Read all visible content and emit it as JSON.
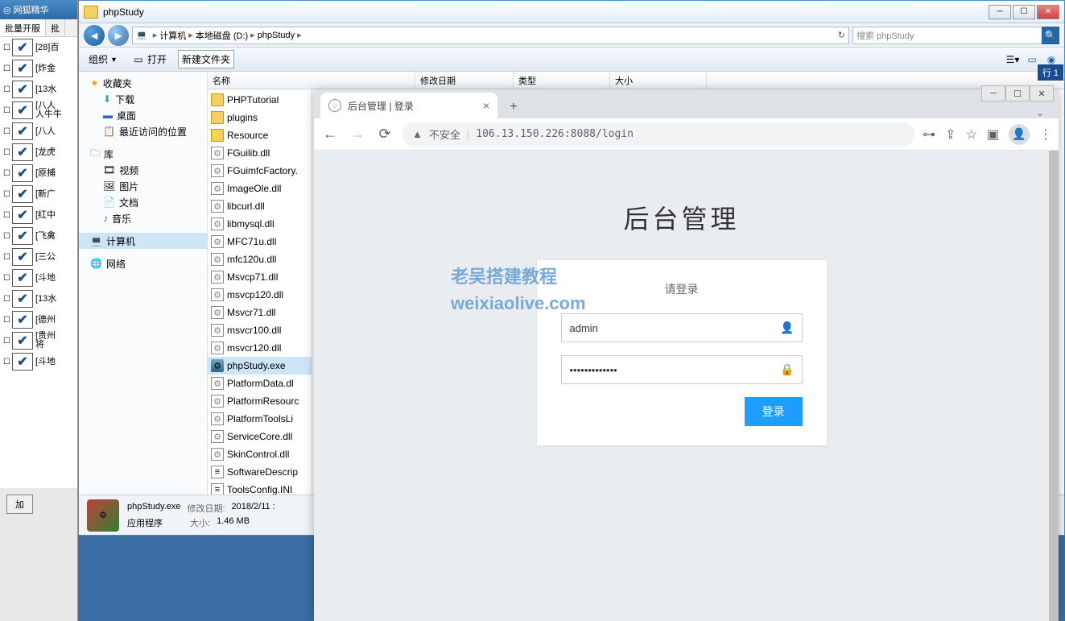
{
  "bg_app": {
    "title": "网狐精华",
    "tabs": [
      "批量开服",
      "批"
    ],
    "items": [
      "[28]百",
      "[炸金",
      "[13水",
      "[八人\n人牛牛",
      "[八人",
      "[龙虎",
      "[原捕",
      "[新广",
      "[红中",
      "[飞禽",
      "[三公",
      "[斗地",
      "[13水",
      "[德州",
      "[贵州\n将",
      "[斗地"
    ],
    "add_btn": "加"
  },
  "explorer": {
    "title": "phpStudy",
    "breadcrumb": [
      "计算机",
      "本地磁盘 (D:)",
      "phpStudy"
    ],
    "search_placeholder": "搜索 phpStudy",
    "toolbar": {
      "org": "组织",
      "open": "打开",
      "newfolder": "新建文件夹"
    },
    "columns": {
      "name": "名称",
      "date": "修改日期",
      "type": "类型",
      "size": "大小"
    },
    "col_widths": {
      "name": 258,
      "date": 122,
      "type": 120,
      "size": 120
    },
    "nav": {
      "favorites": {
        "label": "收藏夹",
        "items": [
          "下载",
          "桌面",
          "最近访问的位置"
        ]
      },
      "libraries": {
        "label": "库",
        "items": [
          "视频",
          "图片",
          "文档",
          "音乐"
        ]
      },
      "computer": "计算机",
      "network": "网络"
    },
    "files": [
      {
        "name": "PHPTutorial",
        "type": "folder"
      },
      {
        "name": "plugins",
        "type": "folder"
      },
      {
        "name": "Resource",
        "type": "folder"
      },
      {
        "name": "FGuilib.dll",
        "type": "dll"
      },
      {
        "name": "FGuimfcFactory.",
        "type": "dll"
      },
      {
        "name": "ImageOle.dll",
        "type": "dll"
      },
      {
        "name": "libcurl.dll",
        "type": "dll"
      },
      {
        "name": "libmysql.dll",
        "type": "dll"
      },
      {
        "name": "MFC71u.dll",
        "type": "dll"
      },
      {
        "name": "mfc120u.dll",
        "type": "dll"
      },
      {
        "name": "Msvcp71.dll",
        "type": "dll"
      },
      {
        "name": "msvcp120.dll",
        "type": "dll"
      },
      {
        "name": "Msvcr71.dll",
        "type": "dll"
      },
      {
        "name": "msvcr100.dll",
        "type": "dll"
      },
      {
        "name": "msvcr120.dll",
        "type": "dll"
      },
      {
        "name": "phpStudy.exe",
        "type": "exe",
        "selected": true
      },
      {
        "name": "PlatformData.dl",
        "type": "dll"
      },
      {
        "name": "PlatformResourc",
        "type": "dll"
      },
      {
        "name": "PlatformToolsLi",
        "type": "dll"
      },
      {
        "name": "ServiceCore.dll",
        "type": "dll"
      },
      {
        "name": "SkinControl.dll",
        "type": "dll"
      },
      {
        "name": "SoftwareDescrip",
        "type": "ini"
      },
      {
        "name": "ToolsConfig.INI",
        "type": "ini"
      }
    ],
    "status": {
      "filename": "phpStudy.exe",
      "date_label": "修改日期:",
      "date": "2018/2/11 :",
      "type": "应用程序",
      "size_label": "大小:",
      "size": "1.46 MB"
    }
  },
  "rowcol": "行 1",
  "browser": {
    "tab_title": "后台管理 | 登录",
    "insecure_label": "不安全",
    "url": "106.13.150.226:8088/login",
    "page": {
      "title": "后台管理",
      "subtitle": "请登录",
      "username": "admin",
      "password": "•••••••••••••",
      "login_btn": "登录"
    }
  },
  "watermark": {
    "line1": "老吴搭建教程",
    "line2": "weixiaolive.com"
  }
}
